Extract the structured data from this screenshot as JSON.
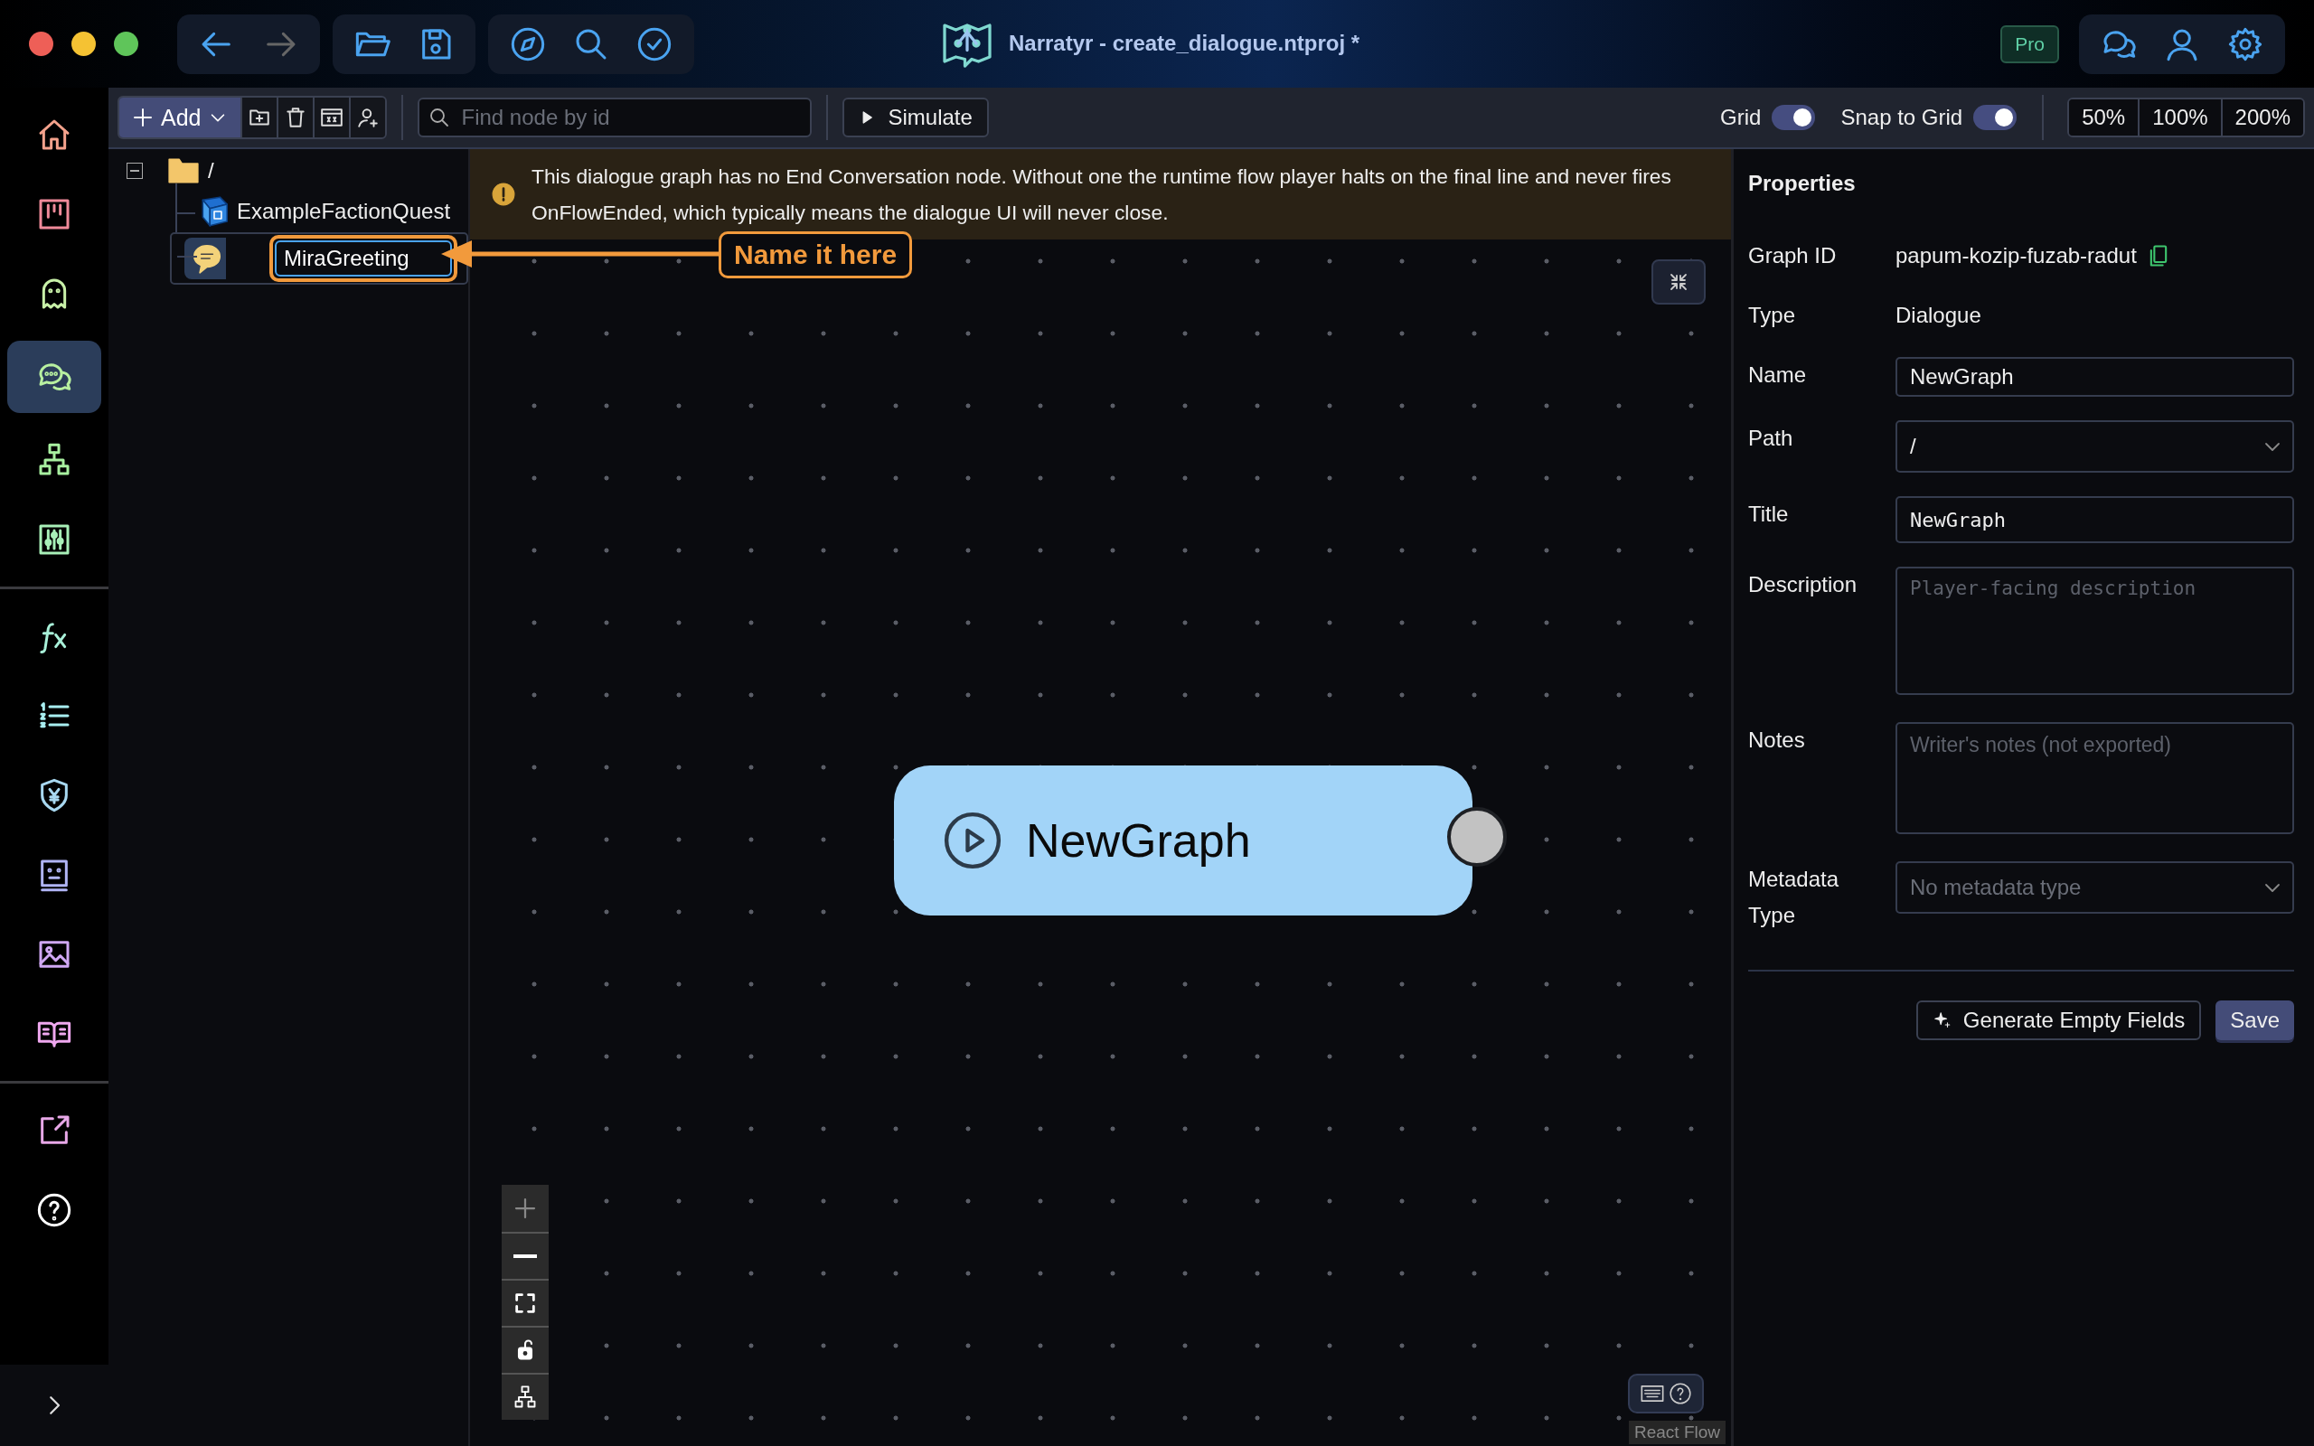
{
  "window": {
    "title": "Narratyr - create_dialogue.ntproj *",
    "badge": "Pro"
  },
  "toolbar": {
    "add_label": "Add",
    "search": {
      "placeholder": "Find node by id"
    },
    "simulate_label": "Simulate",
    "toggles": [
      {
        "label": "Grid",
        "on": true
      },
      {
        "label": "Snap to Grid",
        "on": true
      }
    ],
    "zoom_levels": [
      "50%",
      "100%",
      "200%"
    ]
  },
  "sidebar": {
    "sections": [
      {
        "items": [
          {
            "kind": "home",
            "selected": false
          },
          {
            "kind": "board",
            "selected": false
          },
          {
            "kind": "ghost",
            "selected": false
          },
          {
            "kind": "dialogue",
            "selected": true
          },
          {
            "kind": "hierarchy",
            "selected": false
          },
          {
            "kind": "sliders",
            "selected": false
          }
        ]
      },
      {
        "items": [
          {
            "kind": "function",
            "selected": false
          },
          {
            "kind": "list",
            "selected": false
          },
          {
            "kind": "shield",
            "selected": false
          },
          {
            "kind": "face",
            "selected": false
          },
          {
            "kind": "image",
            "selected": false
          },
          {
            "kind": "book",
            "selected": false
          }
        ]
      },
      {
        "items": [
          {
            "kind": "export",
            "selected": false
          },
          {
            "kind": "help",
            "selected": false
          }
        ]
      }
    ]
  },
  "tree": {
    "root": {
      "label": "/",
      "expanded": true,
      "children": [
        {
          "kind": "quest",
          "label": "ExampleFactionQuest",
          "selected": false
        },
        {
          "kind": "dialogue",
          "value": "MiraGreeting",
          "selected": true
        }
      ]
    }
  },
  "warning": {
    "text": "This dialogue graph has no End Conversation node. Without one the runtime flow player halts on the final line and never fires OnFlowEnded, which typically means the dialogue UI will never close."
  },
  "callout": {
    "text": "Name it here"
  },
  "node": {
    "title": "NewGraph"
  },
  "attribution": "React Flow",
  "properties": {
    "title": "Properties",
    "fields": [
      {
        "label": "Graph ID",
        "kind": "text",
        "value": "papum-kozip-fuzab-radut",
        "copyable": true
      },
      {
        "label": "Type",
        "kind": "text",
        "value": "Dialogue"
      },
      {
        "label": "Name",
        "kind": "input",
        "value": "NewGraph"
      },
      {
        "label": "Path",
        "kind": "select",
        "value": "/"
      },
      {
        "label": "Title",
        "kind": "mono-input",
        "value": "NewGraph"
      },
      {
        "label": "Description",
        "kind": "mono-textarea",
        "placeholder": "Player-facing description"
      },
      {
        "label": "Notes",
        "kind": "textarea",
        "placeholder": "Writer's notes (not exported)"
      },
      {
        "label": "Metadata Type",
        "kind": "select",
        "placeholder": "No metadata type"
      }
    ],
    "buttons": [
      {
        "label": "Generate Empty Fields",
        "kind": "secondary"
      },
      {
        "label": "Save",
        "kind": "primary"
      }
    ]
  }
}
